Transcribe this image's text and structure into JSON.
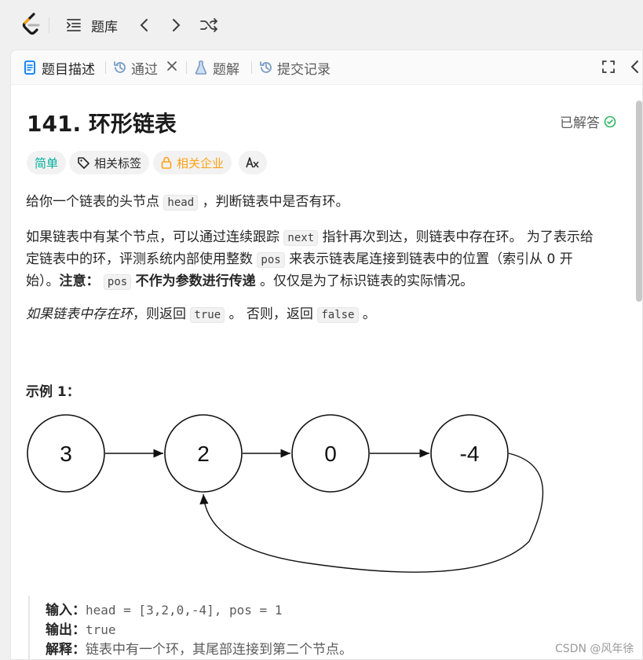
{
  "topbar": {
    "problem_list_label": "题库"
  },
  "tabs": {
    "description": "题目描述",
    "accepted": "通过",
    "solutions": "题解",
    "submissions": "提交记录"
  },
  "problem": {
    "title": "141. 环形链表",
    "status": "已解答",
    "difficulty": "简单",
    "related_tags": "相关标签",
    "related_companies": "相关企业",
    "lang_toggle": "A文"
  },
  "description": {
    "p1_a": "给你一个链表的头节点",
    "p1_code": "head",
    "p1_b": "，判断链表中是否有环。",
    "p2_l1_a": "如果链表中有某个节点，可以通过连续跟踪",
    "p2_l1_code": "next",
    "p2_l1_b": "指针再次到达，则链表中存在环。 为了表示给",
    "p2_l2_a": "定链表中的环，评测系统内部使用整数",
    "p2_l2_code": "pos",
    "p2_l2_b": "来表示链表尾连接到链表中的位置（索引从 0 开",
    "p2_l3_a": "始）。",
    "p2_l3_note": "注意：",
    "p2_l3_code": "pos",
    "p2_l3_bold": "不作为参数进行传递",
    "p2_l3_b": "。仅仅是为了标识链表的实际情况。",
    "p3_em": "如果链表中存在环",
    "p3_a": "，则返回",
    "p3_code1": "true",
    "p3_b": "。 否则，返回",
    "p3_code2": "false",
    "p3_c": "。"
  },
  "example": {
    "title": "示例 1：",
    "nodes": [
      "3",
      "2",
      "0",
      "-4"
    ],
    "input_label": "输入：",
    "input_value": "head = [3,2,0,-4], pos = 1",
    "output_label": "输出：",
    "output_value": "true",
    "explain_label": "解释：",
    "explain_value": "链表中有一个环，其尾部连接到第二个节点。"
  },
  "watermark": "CSDN @风年徐",
  "colors": {
    "easy": "#00af9b",
    "company": "#ffa116",
    "solved": "#2db55d",
    "desc_icon": "#007aff"
  },
  "icons": [
    "leetcode-logo-icon",
    "list-icon",
    "chevron-left-icon",
    "chevron-right-icon",
    "shuffle-icon",
    "document-icon",
    "history-icon",
    "close-icon",
    "flask-icon",
    "expand-icon",
    "check-circle-icon",
    "tag-icon",
    "lock-icon",
    "translate-icon"
  ]
}
